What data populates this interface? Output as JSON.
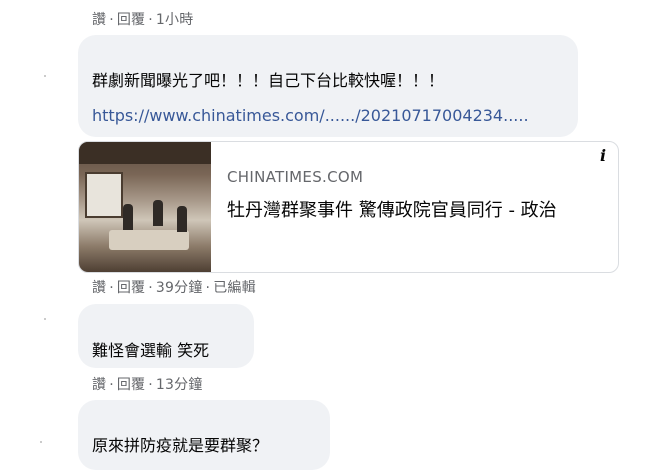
{
  "comments": [
    {
      "meta": {
        "like": "讚",
        "reply": "回覆",
        "time": "1小時"
      }
    },
    {
      "text": "群劇新聞曝光了吧！！！自己下台比較快喔！！！",
      "link_text": "https://www.chinatimes.com/....../20210717004234.....",
      "preview": {
        "domain": "CHINATIMES.COM",
        "title": "牡丹灣群聚事件 驚傳政院官員同行 - 政治"
      },
      "meta": {
        "like": "讚",
        "reply": "回覆",
        "time": "39分鐘",
        "edited": "已編輯"
      }
    },
    {
      "text": "難怪會選輸 笑死",
      "meta": {
        "like": "讚",
        "reply": "回覆",
        "time": "13分鐘"
      }
    },
    {
      "text": "原來拼防疫就是要群聚？"
    }
  ],
  "icons": {
    "info": "info-icon"
  },
  "colors": {
    "bubble": "#f0f2f5",
    "link": "#385898",
    "meta": "#65676b"
  }
}
